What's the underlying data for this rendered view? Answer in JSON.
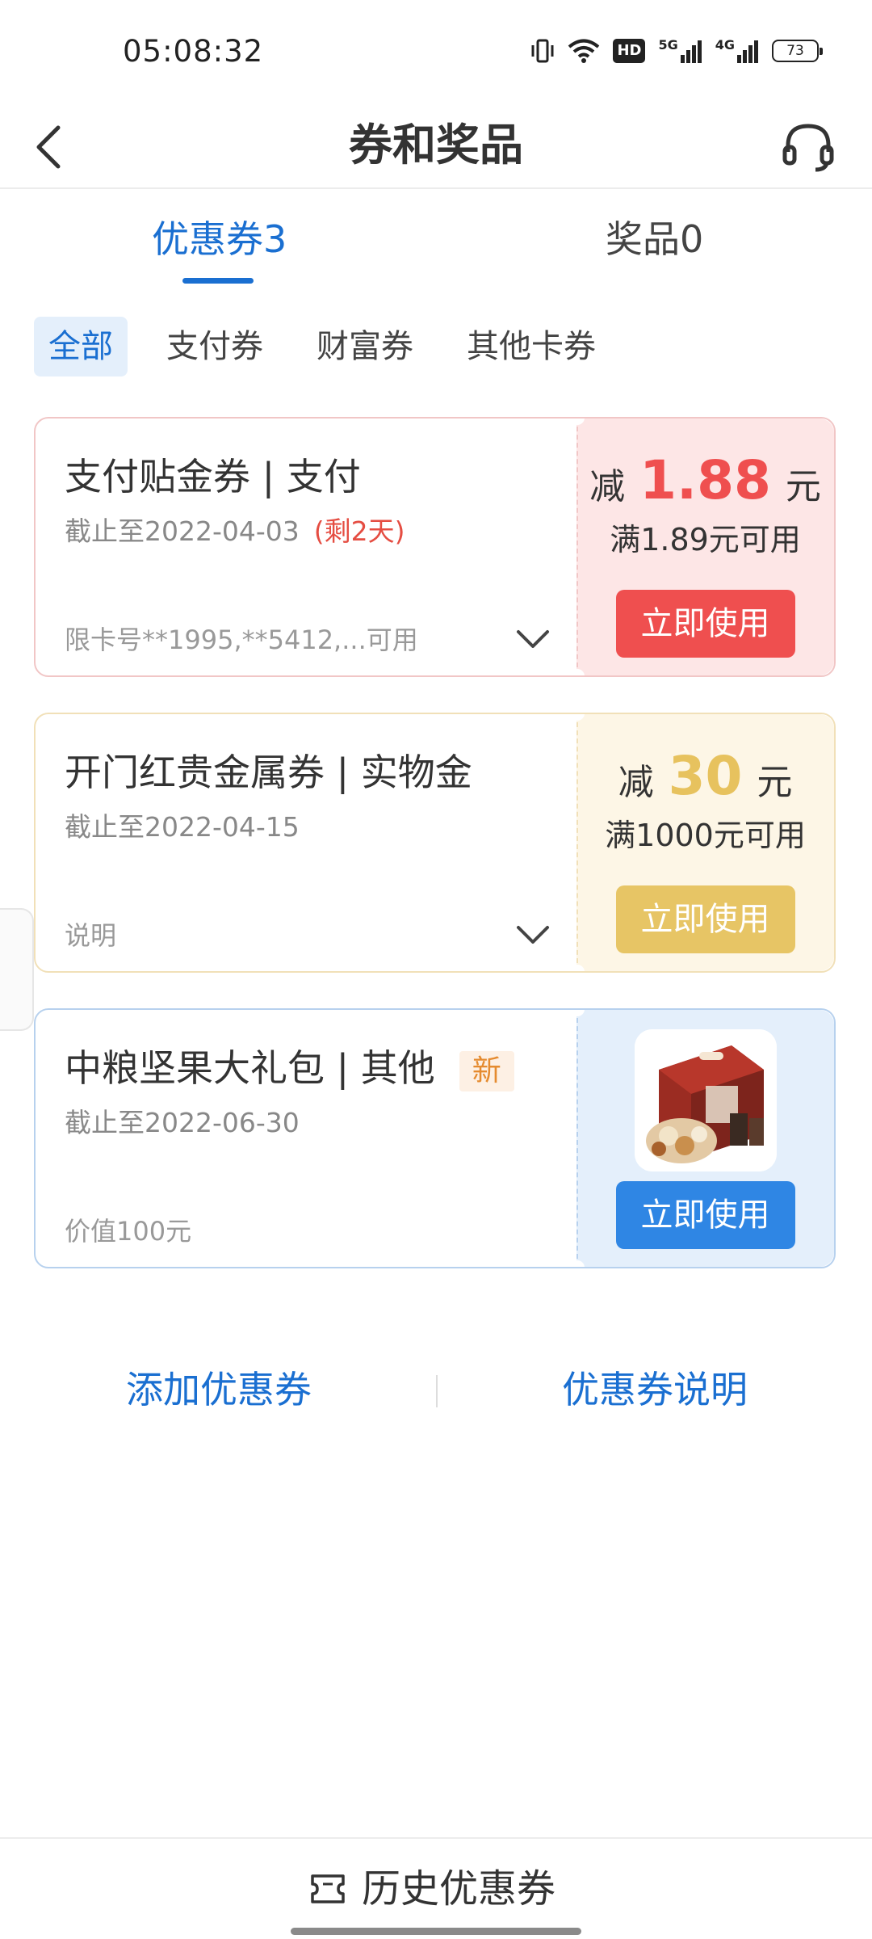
{
  "status_bar": {
    "time": "05:08:32",
    "hd_label": "HD",
    "signal1_label": "5G",
    "signal2_label": "4G",
    "battery_level": "73",
    "icons": [
      "vibrate-icon",
      "wifi-icon",
      "hd-icon",
      "signal-5g-icon",
      "signal-4g-icon",
      "battery-icon"
    ]
  },
  "header": {
    "title": "券和奖品",
    "back_icon": "chevron-left-icon",
    "support_icon": "headset-icon"
  },
  "tabs": [
    {
      "label": "优惠券3",
      "active": true
    },
    {
      "label": "奖品0",
      "active": false
    }
  ],
  "filters": [
    {
      "label": "全部",
      "active": true
    },
    {
      "label": "支付券",
      "active": false
    },
    {
      "label": "财富券",
      "active": false
    },
    {
      "label": "其他卡券",
      "active": false
    }
  ],
  "coupons": [
    {
      "title": "支付贴金券 | 支付",
      "expiry": "截止至2022-04-03",
      "remaining": "(剩2天)",
      "note": "限卡号**1995,**5412,...可用",
      "minus_label": "减",
      "amount": "1.88",
      "unit": "元",
      "condition": "满1.89元可用",
      "button": "立即使用",
      "accent": "#ef4f4f"
    },
    {
      "title": "开门红贵金属券 | 实物金",
      "expiry": "截止至2022-04-15",
      "note": "说明",
      "minus_label": "减",
      "amount": "30",
      "unit": "元",
      "condition": "满1000元可用",
      "button": "立即使用",
      "accent": "#e7c565"
    },
    {
      "title": "中粮坚果大礼包 | 其他",
      "badge": "新",
      "expiry": "截止至2022-06-30",
      "note": "价值100元",
      "button": "立即使用",
      "accent": "#2f86e4"
    }
  ],
  "links": {
    "add": "添加优惠券",
    "info": "优惠券说明"
  },
  "bottom": {
    "history_label": "历史优惠券",
    "history_icon": "ticket-icon"
  },
  "colors": {
    "brand_blue": "#1a6fd1",
    "red": "#ef4f4f",
    "gold": "#e7c565"
  }
}
